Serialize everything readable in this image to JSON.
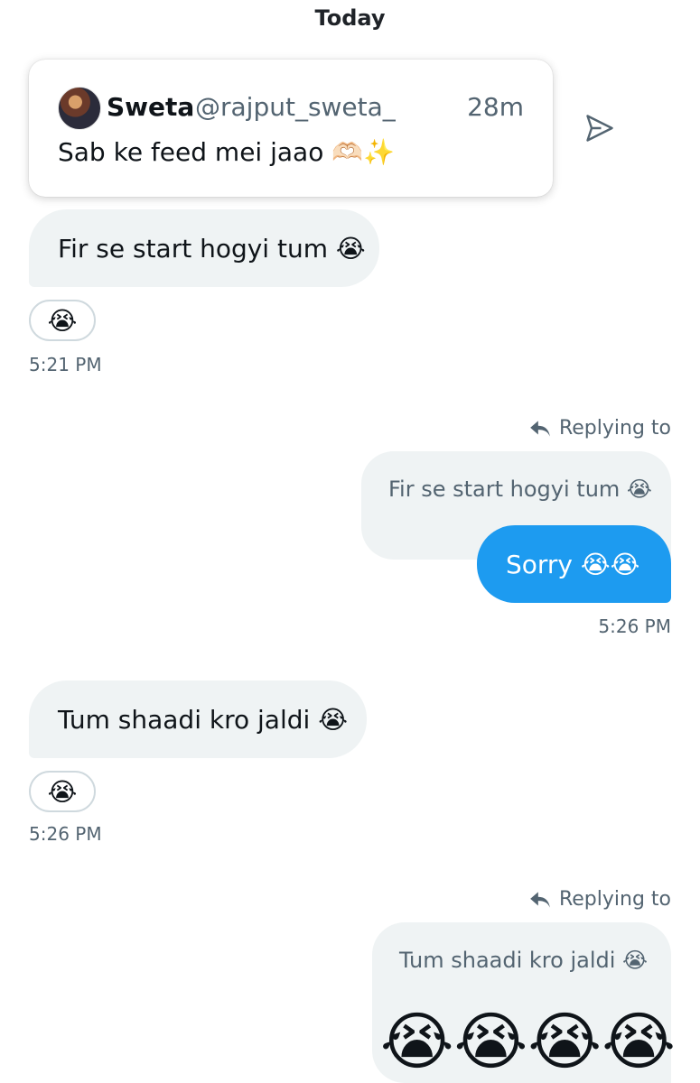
{
  "header": {
    "date_label": "Today"
  },
  "shared_tweet": {
    "author": "Sweta",
    "handle": "@rajput_sweta_",
    "time": "28m",
    "text": "Sab ke feed mei jaao 🫶🏻✨"
  },
  "messages": [
    {
      "direction": "incoming",
      "text": "Fir se start hogyi tum 😭",
      "reaction": "😭",
      "timestamp": "5:21 PM"
    },
    {
      "direction": "outgoing",
      "replying_label": "Replying to",
      "quoted_text": "Fir se start hogyi tum 😭",
      "text": "Sorry 😭😭",
      "timestamp": "5:26 PM"
    },
    {
      "direction": "incoming",
      "text": "Tum shaadi kro jaldi 😭",
      "reaction": "😭",
      "timestamp": "5:26 PM"
    },
    {
      "direction": "outgoing",
      "replying_label": "Replying to",
      "quoted_text": "Tum shaadi kro jaldi 😭",
      "text": "😭😭😭😭"
    }
  ],
  "icons": {
    "share": "share-paper-plane-icon",
    "reply": "reply-arrow-icon",
    "emoji": "loudly-crying-face"
  },
  "colors": {
    "accent": "#1d9bf0",
    "bubble_gray": "#eff3f4",
    "secondary_text": "#536471"
  }
}
